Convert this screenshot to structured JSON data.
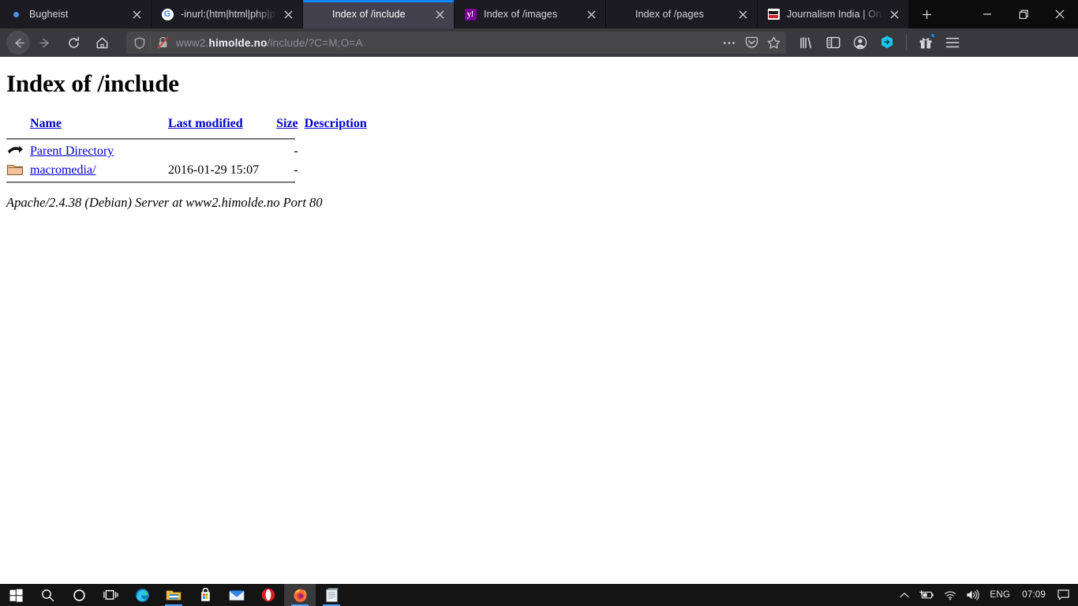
{
  "browser": {
    "tabs": [
      {
        "title": "Bugheist",
        "favicon": "blue-dot-icon",
        "active": false
      },
      {
        "title": "-inurl:(htm|html|php|pls",
        "favicon": "google-icon",
        "active": false
      },
      {
        "title": "Index of /include",
        "favicon": "none",
        "active": true
      },
      {
        "title": "Index of /images",
        "favicon": "yahoo-icon",
        "active": false
      },
      {
        "title": "Index of /pages",
        "favicon": "none",
        "active": false
      },
      {
        "title": "Journalism India | Online",
        "favicon": "india-news-icon",
        "active": false
      }
    ],
    "newtab_label": "+",
    "window_controls": {
      "minimize": "–",
      "restore": "❐",
      "close": "✕"
    },
    "nav": {
      "back": "back-icon",
      "forward": "forward-icon",
      "reload": "reload-icon",
      "home": "home-icon"
    },
    "url": {
      "prefix": "www2.",
      "domain": "himolde.no",
      "path": "/include/?C=M;O=A",
      "full": "www2.himolde.no/include/?C=M;O=A"
    },
    "urlbar_buttons": [
      "ellipsis-icon",
      "pocket-icon",
      "star-icon"
    ],
    "toolbar_buttons": [
      "library-icon",
      "sidebar-icon",
      "account-icon",
      "extension-icon",
      "gift-icon",
      "menu-icon"
    ],
    "accent_color": "#0a84ff",
    "chrome_bg": "#38383d",
    "tabstrip_bg": "#0c0c0d"
  },
  "page": {
    "heading": "Index of /include",
    "table": {
      "headers": [
        "Name",
        "Last modified",
        "Size",
        "Description"
      ],
      "rows": [
        {
          "icon": "parent-directory-icon",
          "name": "Parent Directory",
          "modified": "",
          "size": "-",
          "description": ""
        },
        {
          "icon": "folder-icon",
          "name": "macromedia/",
          "modified": "2016-01-29 15:07",
          "size": "-",
          "description": ""
        }
      ]
    },
    "footer": "Apache/2.4.38 (Debian) Server at www2.himolde.no Port 80",
    "link_color": "#0000cc"
  },
  "taskbar": {
    "items": [
      {
        "name": "start-button",
        "icon": "windows-icon"
      },
      {
        "name": "search-button",
        "icon": "search-icon"
      },
      {
        "name": "cortana-button",
        "icon": "cortana-icon"
      },
      {
        "name": "task-view-button",
        "icon": "task-view-icon"
      },
      {
        "name": "edge-button",
        "icon": "edge-icon"
      },
      {
        "name": "file-explorer-button",
        "icon": "folder-icon"
      },
      {
        "name": "microsoft-store-button",
        "icon": "store-icon"
      },
      {
        "name": "mail-button",
        "icon": "mail-icon"
      },
      {
        "name": "opera-button",
        "icon": "opera-icon"
      },
      {
        "name": "firefox-button",
        "icon": "firefox-icon"
      },
      {
        "name": "notepad-button",
        "icon": "notepad-icon"
      }
    ],
    "tray": {
      "overflow": "chevron-up-icon",
      "battery": "battery-charging-icon",
      "network": "wifi-icon",
      "volume": "volume-icon",
      "language": "ENG",
      "clock": "07:09",
      "action_center": "action-center-icon"
    }
  }
}
